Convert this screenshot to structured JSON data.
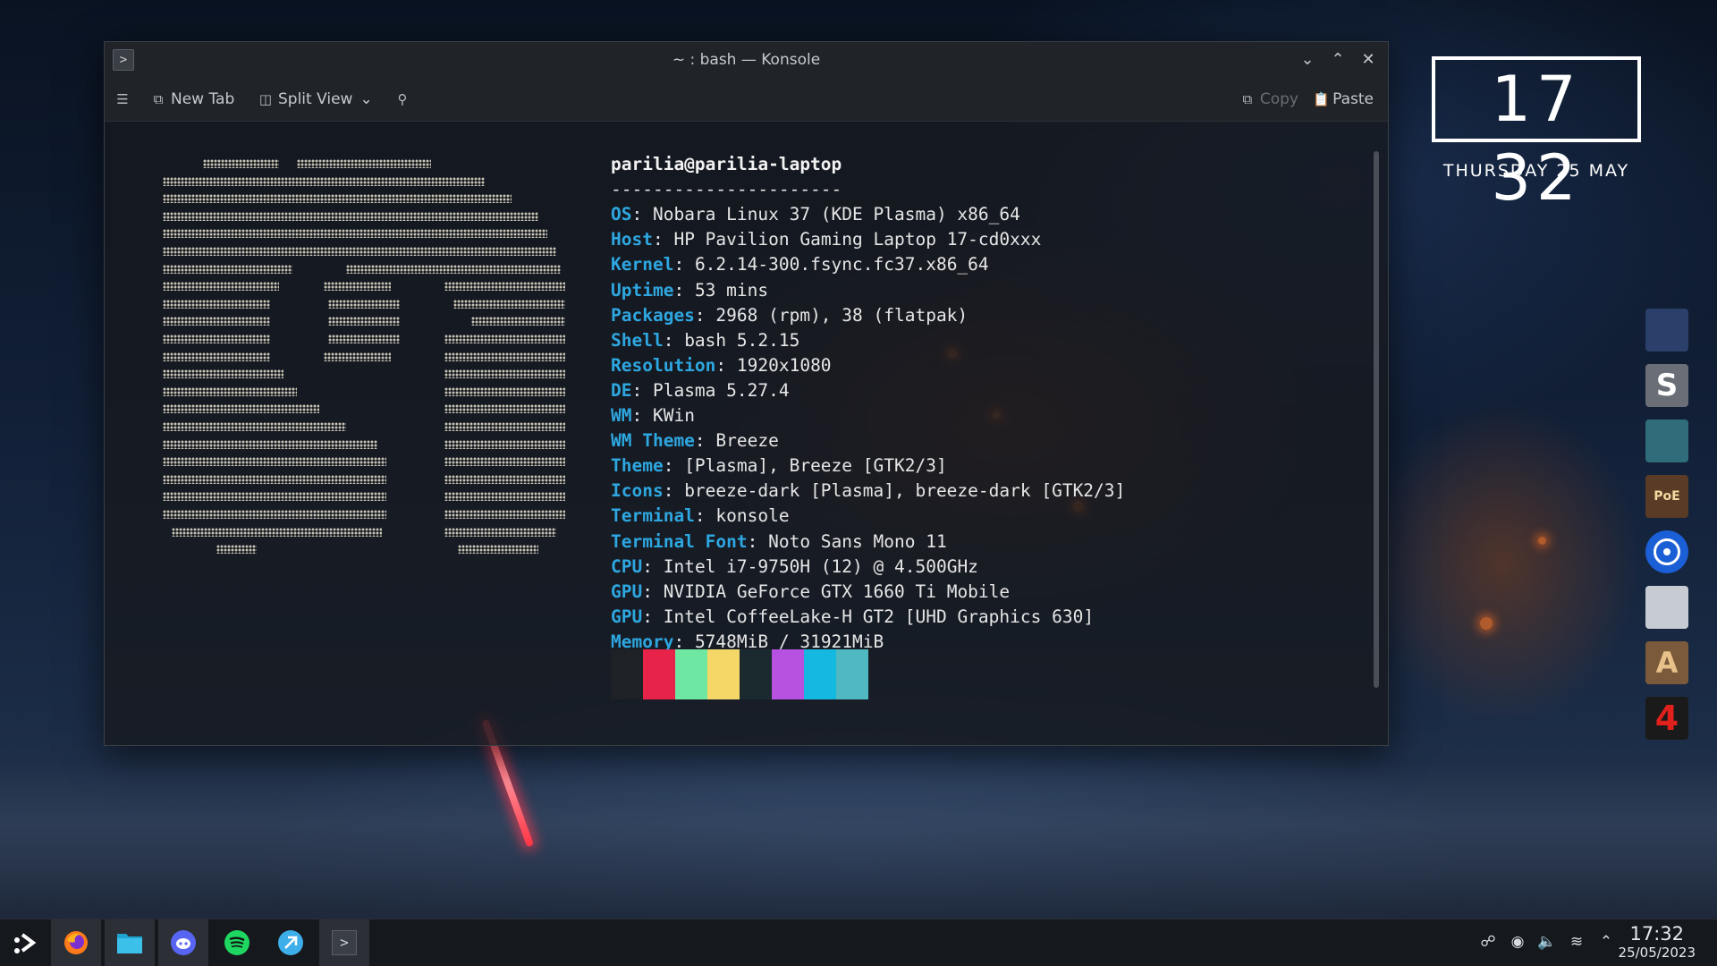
{
  "window": {
    "title": "~ : bash — Konsole",
    "toolbar": {
      "new_tab": "New Tab",
      "split_view": "Split View",
      "copy": "Copy",
      "paste": "Paste"
    }
  },
  "neofetch": {
    "user_host": "parilia@parilia-laptop",
    "separator": "----------------------",
    "rows": [
      {
        "key": "OS",
        "value": "Nobara Linux 37 (KDE Plasma) x86_64"
      },
      {
        "key": "Host",
        "value": "HP Pavilion Gaming Laptop 17-cd0xxx"
      },
      {
        "key": "Kernel",
        "value": "6.2.14-300.fsync.fc37.x86_64"
      },
      {
        "key": "Uptime",
        "value": "53 mins"
      },
      {
        "key": "Packages",
        "value": "2968 (rpm), 38 (flatpak)"
      },
      {
        "key": "Shell",
        "value": "bash 5.2.15"
      },
      {
        "key": "Resolution",
        "value": "1920x1080"
      },
      {
        "key": "DE",
        "value": "Plasma 5.27.4"
      },
      {
        "key": "WM",
        "value": "KWin"
      },
      {
        "key": "WM Theme",
        "value": "Breeze"
      },
      {
        "key": "Theme",
        "value": "[Plasma], Breeze [GTK2/3]"
      },
      {
        "key": "Icons",
        "value": "breeze-dark [Plasma], breeze-dark [GTK2/3]"
      },
      {
        "key": "Terminal",
        "value": "konsole"
      },
      {
        "key": "Terminal Font",
        "value": "Noto Sans Mono 11"
      },
      {
        "key": "CPU",
        "value": "Intel i7-9750H (12) @ 4.500GHz"
      },
      {
        "key": "GPU",
        "value": "NVIDIA GeForce GTX 1660 Ti Mobile"
      },
      {
        "key": "GPU",
        "value": "Intel CoffeeLake-H GT2 [UHD Graphics 630]"
      },
      {
        "key": "Memory",
        "value": "5748MiB / 31921MiB"
      }
    ],
    "palette": [
      "#232627",
      "#ed1515",
      "#11d116",
      "#f67400",
      "#1d99f3",
      "#9b59b6",
      "#1abc9c",
      "#fcfcfc"
    ],
    "palette_shown": [
      "#1e2226",
      "#e8234a",
      "#6ee7a3",
      "#f4d767",
      "#1b2a2e",
      "#b651e0",
      "#14b8e0",
      "#4fb8c0"
    ],
    "key_color": "#2ea7e0"
  },
  "clock": {
    "time": "17 32",
    "date": "THURSDAY 25 MAY"
  },
  "dock": {
    "items": [
      {
        "name": "game-1",
        "glyph": "",
        "color": "#2b3f6b"
      },
      {
        "name": "game-s",
        "glyph": "S",
        "color": "#6a6f77"
      },
      {
        "name": "game-planet",
        "glyph": "",
        "color": "#2f6d7a"
      },
      {
        "name": "game-poe",
        "glyph": "PoE",
        "color": "#5a3b25"
      },
      {
        "name": "app-blue-circle",
        "glyph": "",
        "color": "#1b5fd6"
      },
      {
        "name": "game-skull",
        "glyph": "",
        "color": "#c7ccd2"
      },
      {
        "name": "game-a",
        "glyph": "A",
        "color": "#7a5a3a"
      },
      {
        "name": "game-4",
        "glyph": "4",
        "color": "#1a1a1a"
      }
    ]
  },
  "taskbar": {
    "apps": [
      "launcher",
      "firefox",
      "files",
      "discord",
      "spotify",
      "kde-connect",
      "konsole"
    ],
    "time": "17:32",
    "date": "25/05/2023"
  }
}
